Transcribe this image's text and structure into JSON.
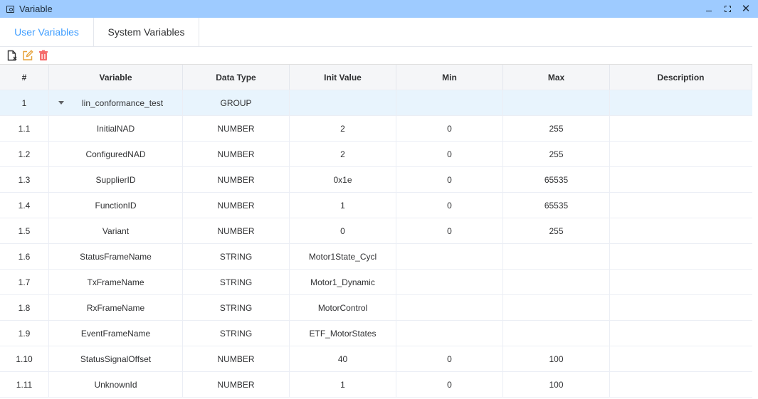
{
  "window": {
    "title": "Variable",
    "icon": "variable-window-icon",
    "controls": [
      "minimize-icon",
      "maximize-icon",
      "close-icon"
    ],
    "close_glyph": "✕"
  },
  "tabs": [
    {
      "label": "User Variables",
      "active": true
    },
    {
      "label": "System Variables",
      "active": false
    }
  ],
  "toolbar": {
    "icons": [
      "new-file-icon",
      "edit-icon",
      "delete-icon"
    ],
    "colors": {
      "new": "#303133",
      "edit": "#e6a23c",
      "delete": "#f56c6c"
    }
  },
  "table": {
    "headers": [
      "#",
      "Variable",
      "Data Type",
      "Init Value",
      "Min",
      "Max",
      "Description"
    ],
    "group": {
      "index": "1",
      "name": "lin_conformance_test",
      "type": "GROUP",
      "expanded": true
    },
    "rows": [
      {
        "index": "1.1",
        "name": "InitialNAD",
        "type": "NUMBER",
        "init": "2",
        "min": "0",
        "max": "255",
        "desc": ""
      },
      {
        "index": "1.2",
        "name": "ConfiguredNAD",
        "type": "NUMBER",
        "init": "2",
        "min": "0",
        "max": "255",
        "desc": ""
      },
      {
        "index": "1.3",
        "name": "SupplierID",
        "type": "NUMBER",
        "init": "0x1e",
        "min": "0",
        "max": "65535",
        "desc": ""
      },
      {
        "index": "1.4",
        "name": "FunctionID",
        "type": "NUMBER",
        "init": "1",
        "min": "0",
        "max": "65535",
        "desc": ""
      },
      {
        "index": "1.5",
        "name": "Variant",
        "type": "NUMBER",
        "init": "0",
        "min": "0",
        "max": "255",
        "desc": ""
      },
      {
        "index": "1.6",
        "name": "StatusFrameName",
        "type": "STRING",
        "init": "Motor1State_Cycl",
        "min": "",
        "max": "",
        "desc": ""
      },
      {
        "index": "1.7",
        "name": "TxFrameName",
        "type": "STRING",
        "init": "Motor1_Dynamic",
        "min": "",
        "max": "",
        "desc": ""
      },
      {
        "index": "1.8",
        "name": "RxFrameName",
        "type": "STRING",
        "init": "MotorControl",
        "min": "",
        "max": "",
        "desc": ""
      },
      {
        "index": "1.9",
        "name": "EventFrameName",
        "type": "STRING",
        "init": "ETF_MotorStates",
        "min": "",
        "max": "",
        "desc": ""
      },
      {
        "index": "1.10",
        "name": "StatusSignalOffset",
        "type": "NUMBER",
        "init": "40",
        "min": "0",
        "max": "100",
        "desc": ""
      },
      {
        "index": "1.11",
        "name": "UnknownId",
        "type": "NUMBER",
        "init": "1",
        "min": "0",
        "max": "100",
        "desc": ""
      }
    ]
  },
  "colors": {
    "titlebar": "#9ecbff",
    "accent": "#409eff",
    "group_row": "#e8f4fd"
  }
}
